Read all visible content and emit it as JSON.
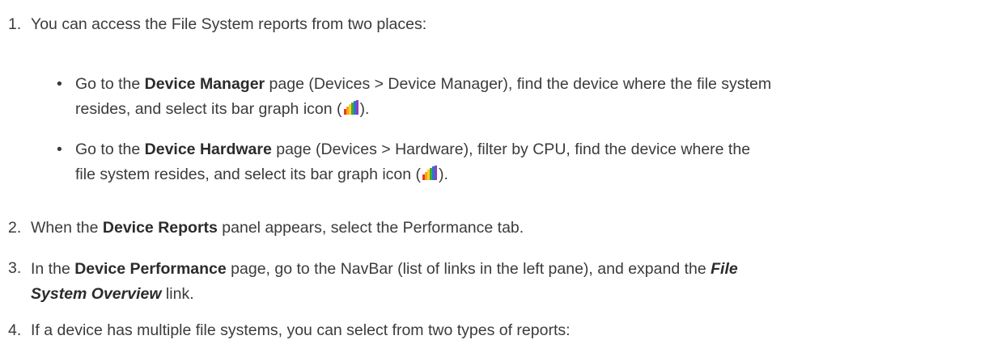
{
  "steps": [
    {
      "num": "1.",
      "text": "You can access the File System reports from two places:"
    },
    {
      "num": "2.",
      "pre": "When the ",
      "bold": "Device Reports",
      "post": " panel appears, select the Performance tab."
    },
    {
      "num": "3.",
      "pre": "In the ",
      "bold": "Device Performance",
      "mid": " page, go to the NavBar (list of links in the left pane), and expand the ",
      "bold_italic_1": "File",
      "bold_italic_2": "System Overview",
      "post": " link."
    },
    {
      "num": "4.",
      "text": "If a device has multiple file systems, you can select from two types of reports:"
    }
  ],
  "bullets": [
    {
      "marker": "•",
      "pre": "Go to the ",
      "bold": "Device Manager",
      "mid": " page (Devices > Device Manager), find the device where the file system",
      "line2": "resides, and select its bar graph icon (",
      "post": ")."
    },
    {
      "marker": "•",
      "pre": "Go to the ",
      "bold": "Device Hardware",
      "mid": " page (Devices > Hardware), filter by CPU, find the device where the",
      "line2": "file system resides, and select its bar graph icon (",
      "post": ")."
    }
  ],
  "icons": {
    "bar_graph": "bar-graph-icon",
    "colors": [
      "#e8392a",
      "#f4a323",
      "#ffd21f",
      "#3da93a",
      "#2a74d4",
      "#8c3fc0"
    ]
  }
}
